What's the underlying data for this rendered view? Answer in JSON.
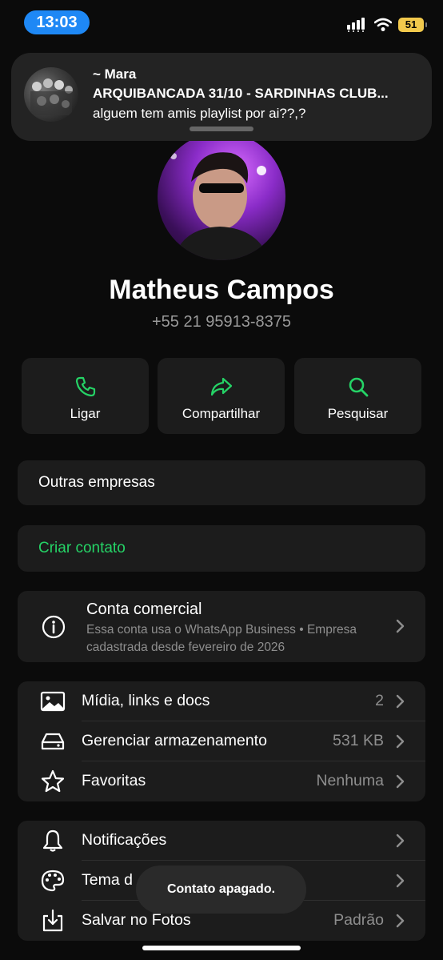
{
  "status_bar": {
    "time": "13:03",
    "battery": "51",
    "icons": [
      "cellular-signal-icon",
      "wifi-icon",
      "battery-icon"
    ]
  },
  "notification": {
    "sender": "~ Mara",
    "group": "ARQUIBANCADA 31/10 - SARDINHAS CLUB...",
    "message": "alguem tem amis playlist por ai??,?"
  },
  "profile": {
    "name": "Matheus Campos",
    "phone": "+55 21 95913-8375"
  },
  "actions": [
    {
      "label": "Ligar",
      "icon": "phone-icon"
    },
    {
      "label": "Compartilhar",
      "icon": "share-icon"
    },
    {
      "label": "Pesquisar",
      "icon": "search-icon"
    }
  ],
  "outras_empresas": "Outras empresas",
  "criar_contato": "Criar contato",
  "business": {
    "title": "Conta comercial",
    "description": "Essa conta usa o WhatsApp Business • Empresa cadastrada desde fevereiro de 2026"
  },
  "media_section": [
    {
      "label": "Mídia, links e docs",
      "value": "2",
      "icon": "image-icon"
    },
    {
      "label": "Gerenciar armazenamento",
      "value": "531 KB",
      "icon": "storage-icon"
    },
    {
      "label": "Favoritas",
      "value": "Nenhuma",
      "icon": "star-icon"
    }
  ],
  "settings_section": [
    {
      "label": "Notificações",
      "value": "",
      "icon": "bell-icon"
    },
    {
      "label": "Tema d",
      "value": "",
      "icon": "palette-icon"
    },
    {
      "label": "Salvar no Fotos",
      "value": "Padrão",
      "icon": "download-icon"
    }
  ],
  "toast": "Contato apagado.",
  "colors": {
    "accent": "#25d366",
    "background": "#0b0b0b",
    "card": "#1c1c1c",
    "time_pill": "#1e88f5",
    "battery": "#f2c94c"
  }
}
